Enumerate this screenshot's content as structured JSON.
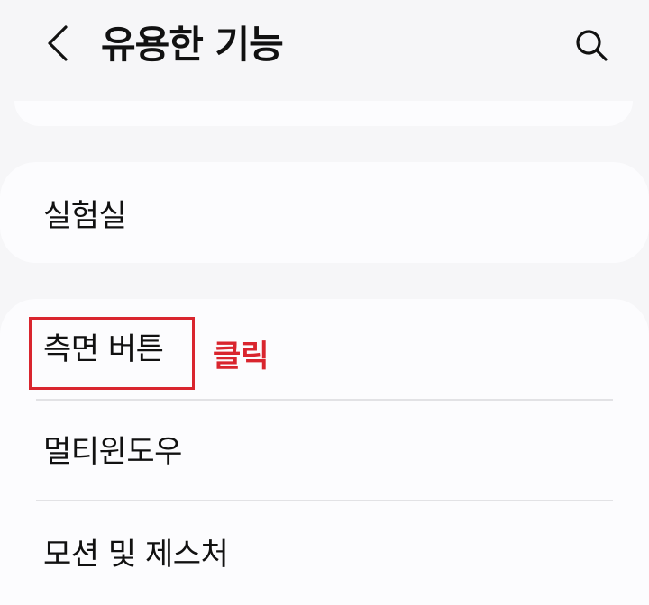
{
  "header": {
    "title": "유용한 기능",
    "back_icon": "chevron-left-icon",
    "search_icon": "search-icon"
  },
  "lab": {
    "label": "실험실"
  },
  "list": {
    "items": [
      {
        "label": "측면 버튼"
      },
      {
        "label": "멀티윈도우"
      },
      {
        "label": "모션 및 제스처"
      }
    ]
  },
  "annotation": {
    "text": "클릭",
    "color": "#d9252e"
  }
}
